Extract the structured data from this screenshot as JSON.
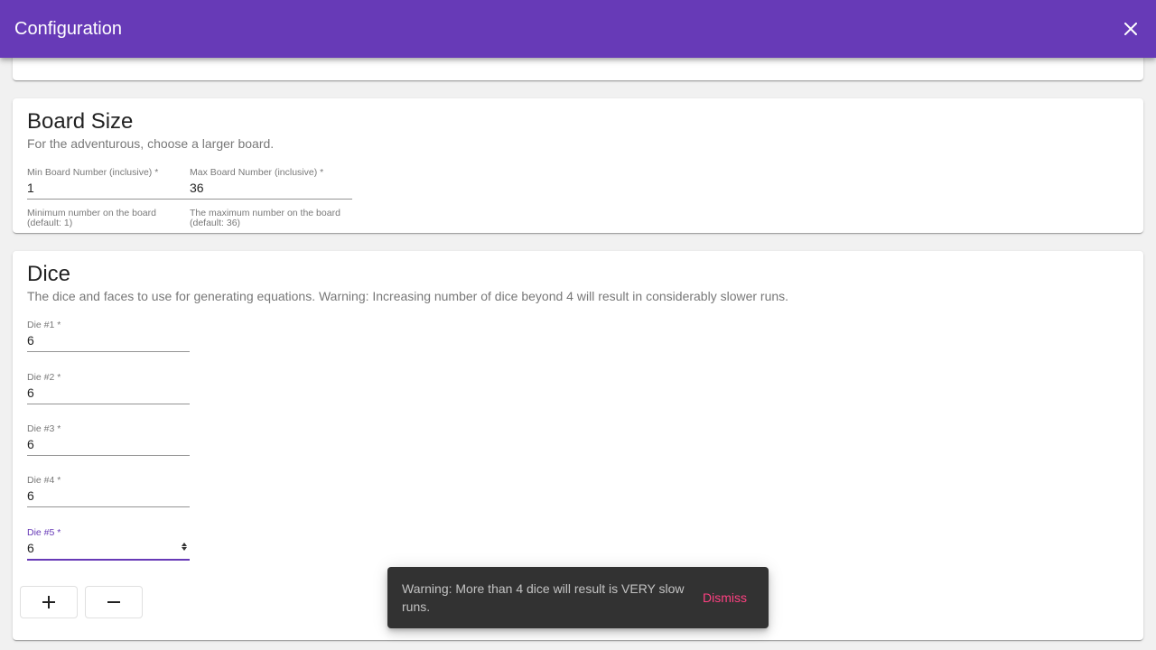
{
  "toolbar": {
    "title": "Configuration",
    "close_icon": "close-icon"
  },
  "board_size": {
    "title": "Board Size",
    "subtitle": "For the adventurous, choose a larger board.",
    "min_field": {
      "label": "Min Board Number (inclusive) *",
      "value": "1",
      "hint": "Minimum number on the board (default: 1)"
    },
    "max_field": {
      "label": "Max Board Number (inclusive) *",
      "value": "36",
      "hint": "The maximum number on the board (default: 36)"
    }
  },
  "dice": {
    "title": "Dice",
    "subtitle": "The dice and faces to use for generating equations. Warning: Increasing number of dice beyond 4 will result in considerably slower runs.",
    "dies": [
      {
        "label": "Die #1 *",
        "value": "6"
      },
      {
        "label": "Die #2 *",
        "value": "6"
      },
      {
        "label": "Die #3 *",
        "value": "6"
      },
      {
        "label": "Die #4 *",
        "value": "6"
      },
      {
        "label": "Die #5 *",
        "value": "6",
        "focused": true
      }
    ],
    "add_icon": "plus-icon",
    "remove_icon": "minus-icon"
  },
  "snackbar": {
    "message": "Warning: More than 4 dice will result is VERY slow runs.",
    "action": "Dismiss"
  },
  "colors": {
    "primary": "#673ab7",
    "accent": "#ff4081",
    "snackbar_bg": "#323232",
    "page_bg": "#f1f1f1"
  }
}
